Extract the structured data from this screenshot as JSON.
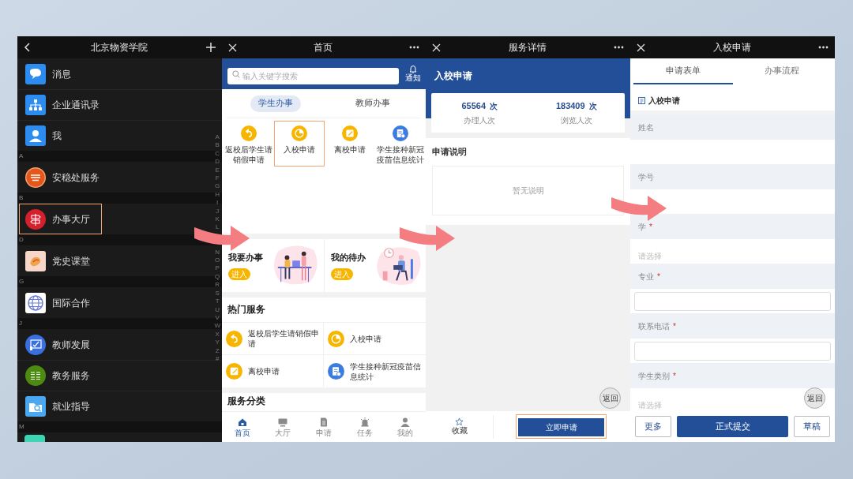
{
  "contacts_screen": {
    "title": "北京物资学院",
    "groups": [
      {
        "items": [
          {
            "label": "消息",
            "highlighted": false
          },
          {
            "label": "企业通讯录",
            "highlighted": false
          },
          {
            "label": "我",
            "highlighted": false
          }
        ]
      },
      {
        "header": "A",
        "items": [
          {
            "label": "安稳处服务",
            "highlighted": false
          }
        ]
      },
      {
        "header": "B",
        "items": [
          {
            "label": "办事大厅",
            "highlighted": true
          }
        ]
      },
      {
        "header": "D",
        "items": [
          {
            "label": "党史课堂",
            "highlighted": false
          }
        ]
      },
      {
        "header": "G",
        "items": [
          {
            "label": "国际合作",
            "highlighted": false
          }
        ]
      },
      {
        "header": "J",
        "items": [
          {
            "label": "教师发展",
            "highlighted": false
          },
          {
            "label": "教务服务",
            "highlighted": false
          },
          {
            "label": "就业指导",
            "highlighted": false
          }
        ]
      },
      {
        "header": "M",
        "cut_item": true
      }
    ],
    "index_letters_top": [
      "A",
      "B",
      "C",
      "D",
      "E",
      "F",
      "G",
      "H",
      "I",
      "J",
      "K",
      "L"
    ],
    "index_letters_bottom": [
      "N",
      "O",
      "P",
      "Q",
      "R",
      "S",
      "T",
      "U",
      "V",
      "W",
      "X",
      "Y",
      "Z",
      "#"
    ]
  },
  "home_screen": {
    "title": "首页",
    "search": {
      "placeholder": "输入关键字搜索"
    },
    "notice": "通知",
    "tabs": [
      {
        "label": "学生办事",
        "selected": true
      },
      {
        "label": "教师办事",
        "selected": false
      }
    ],
    "services": [
      {
        "label": "返校后学生请销假申请",
        "highlighted": false
      },
      {
        "label": "入校申请",
        "highlighted": true
      },
      {
        "label": "离校申请",
        "highlighted": false
      },
      {
        "label": "学生接种新冠疫苗信息统计",
        "highlighted": false
      }
    ],
    "cards": [
      {
        "title": "我要办事",
        "button": "进入"
      },
      {
        "title": "我的待办",
        "button": "进入"
      }
    ],
    "hot_title": "热门服务",
    "hot_services": [
      "返校后学生请销假申请",
      "入校申请",
      "离校申请",
      "学生接种新冠疫苗信息统计"
    ],
    "category_title": "服务分类",
    "nav": [
      {
        "label": "首页",
        "selected": true
      },
      {
        "label": "大厅",
        "selected": false
      },
      {
        "label": "申请",
        "selected": false
      },
      {
        "label": "任务",
        "selected": false
      },
      {
        "label": "我的",
        "selected": false
      }
    ]
  },
  "detail_screen": {
    "title": "服务详情",
    "heading": "入校申请",
    "stats": [
      {
        "value": "65564",
        "unit": "次",
        "label": "办理人次"
      },
      {
        "value": "183409",
        "unit": "次",
        "label": "浏览人次"
      }
    ],
    "section_title": "申请说明",
    "empty_text": "暂无说明",
    "back": "返回",
    "favorite": "收藏",
    "apply": {
      "label": "立即申请",
      "highlighted": true
    }
  },
  "form_screen": {
    "title": "入校申请",
    "tabs": [
      {
        "label": "申请表单",
        "selected": true
      },
      {
        "label": "办事流程",
        "selected": false
      }
    ],
    "form_title": "入校申请",
    "fields": [
      {
        "label": "姓名",
        "kind": "plain"
      },
      {
        "label": "学号",
        "kind": "plain"
      },
      {
        "label": "学",
        "mark": "*",
        "kind": "select",
        "placeholder": "请选择"
      },
      {
        "label": "专业",
        "mark": "*",
        "kind": "input"
      },
      {
        "label": "联系电话",
        "mark": "*",
        "kind": "input"
      },
      {
        "label": "学生类别",
        "mark": "*",
        "kind": "select",
        "placeholder": "请选择"
      }
    ],
    "back": "返回",
    "buttons": [
      {
        "label": "更多",
        "kind": "outline"
      },
      {
        "label": "正式提交",
        "kind": "primary"
      },
      {
        "label": "草稿",
        "kind": "outline"
      }
    ]
  }
}
